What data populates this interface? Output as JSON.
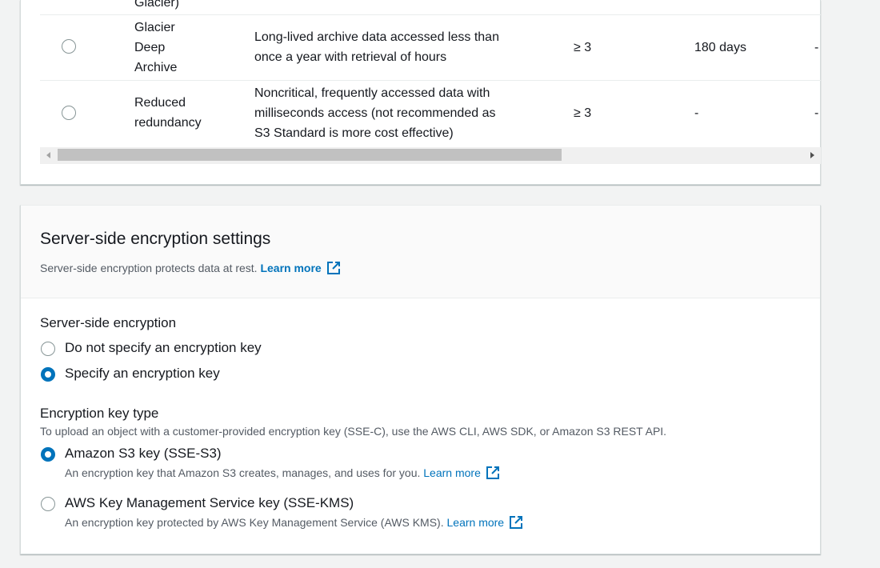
{
  "storage_table": {
    "partial_row_top": "Glacier)",
    "rows": [
      {
        "name": [
          "Glacier",
          "Deep",
          "Archive"
        ],
        "use_case": [
          "Long-lived archive data accessed less than",
          "once a year with retrieval of hours"
        ],
        "az": "≥ 3",
        "min_duration": "180 days",
        "extra": "-",
        "selected": false
      },
      {
        "name": [
          "Reduced",
          "redundancy"
        ],
        "use_case": [
          "Noncritical, frequently accessed data with",
          "milliseconds access (not recommended as",
          "S3 Standard is more cost effective)"
        ],
        "az": "≥ 3",
        "min_duration": "-",
        "extra": "-",
        "selected": false
      }
    ]
  },
  "encryption": {
    "title": "Server-side encryption settings",
    "description": "Server-side encryption protects data at rest.",
    "learn_more": "Learn more",
    "sse_label": "Server-side encryption",
    "sse_options": [
      {
        "label": "Do not specify an encryption key",
        "selected": false
      },
      {
        "label": "Specify an encryption key",
        "selected": true
      }
    ],
    "key_type_label": "Encryption key type",
    "key_type_hint": "To upload an object with a customer-provided encryption key (SSE-C), use the AWS CLI, AWS SDK, or Amazon S3 REST API.",
    "key_type_options": [
      {
        "label": "Amazon S3 key (SSE-S3)",
        "description": "An encryption key that Amazon S3 creates, manages, and uses for you.",
        "learn_more": "Learn more",
        "selected": true
      },
      {
        "label": "AWS Key Management Service key (SSE-KMS)",
        "description": "An encryption key protected by AWS Key Management Service (AWS KMS).",
        "learn_more": "Learn more",
        "selected": false
      }
    ]
  },
  "colors": {
    "link": "#0073bb",
    "radio_selected": "#0073bb",
    "radio_border": "#879596"
  }
}
